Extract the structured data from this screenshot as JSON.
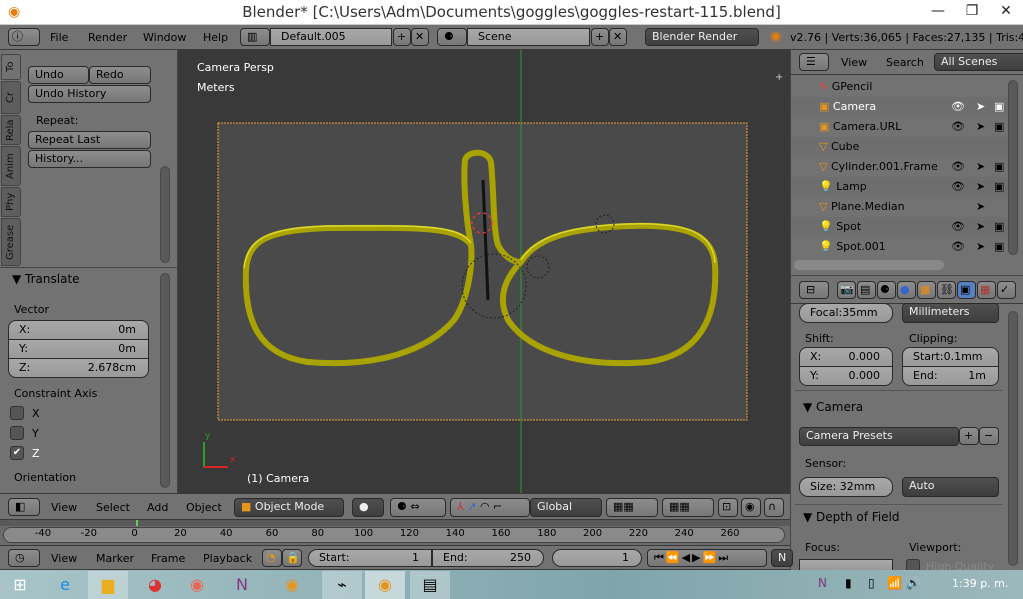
{
  "window": {
    "title": "Blender* [C:\\Users\\Adm\\Documents\\goggles\\goggles-restart-115.blend]",
    "minimize": "—",
    "maximize": "❐",
    "close": "✕"
  },
  "info_header": {
    "menus": [
      "File",
      "Render",
      "Window",
      "Help"
    ],
    "screen_layout": "Default.005",
    "scene": "Scene",
    "render_engine": "Blender Render",
    "stats": "v2.76 | Verts:36,065 | Faces:27,135 | Tris:4"
  },
  "tool_tabs": [
    "To",
    "Cr",
    "Rela",
    "Anim",
    "Phy",
    "Grease"
  ],
  "tools": {
    "undo": "Undo",
    "redo": "Redo",
    "undo_history": "Undo History",
    "repeat_label": "Repeat:",
    "repeat_last": "Repeat Last",
    "history": "History..."
  },
  "operator": {
    "title": "Translate",
    "vector_label": "Vector",
    "x_label": "X:",
    "x": "0m",
    "y_label": "Y:",
    "y": "0m",
    "z_label": "Z:",
    "z": "2.678cm",
    "constraint_label": "Constraint Axis",
    "axes": [
      {
        "label": "X",
        "checked": false
      },
      {
        "label": "Y",
        "checked": false
      },
      {
        "label": "Z",
        "checked": true
      }
    ],
    "orientation_label": "Orientation"
  },
  "viewport": {
    "view_name": "Camera Persp",
    "units": "Meters",
    "object_label": "(1) Camera",
    "axis_x": "x",
    "axis_y": "y",
    "frame_color": "#f0a030",
    "object_color": "#b8b400"
  },
  "view3d_header": {
    "menus": [
      "View",
      "Select",
      "Add",
      "Object"
    ],
    "mode": "Object Mode",
    "orientation": "Global"
  },
  "timeline": {
    "ticks": [
      "-40",
      "-20",
      "0",
      "20",
      "40",
      "60",
      "80",
      "100",
      "120",
      "140",
      "160",
      "180",
      "200",
      "220",
      "240",
      "260"
    ],
    "menus": [
      "View",
      "Marker",
      "Frame",
      "Playback"
    ],
    "start_label": "Start:",
    "start": "1",
    "end_label": "End:",
    "end": "250",
    "current": "1",
    "extra": "N"
  },
  "outliner": {
    "menus": [
      "View",
      "Search"
    ],
    "filter": "All Scenes",
    "items": [
      {
        "name": "GPencil",
        "icon": "pencil-icon",
        "visible": false
      },
      {
        "name": "Camera",
        "icon": "camera-icon",
        "visible": true,
        "active": true
      },
      {
        "name": "Camera.URL",
        "icon": "camera-icon",
        "visible": true
      },
      {
        "name": "Cube",
        "icon": "mesh-icon",
        "visible": false
      },
      {
        "name": "Cylinder.001.Frame",
        "icon": "mesh-icon",
        "visible": true
      },
      {
        "name": "Lamp",
        "icon": "lamp-icon",
        "visible": true
      },
      {
        "name": "Plane.Median",
        "icon": "mesh-icon",
        "visible": false
      },
      {
        "name": "Spot",
        "icon": "lamp-icon",
        "visible": true
      },
      {
        "name": "Spot.001",
        "icon": "lamp-icon",
        "visible": true
      }
    ]
  },
  "properties": {
    "focal": "Focal:35mm",
    "lens_unit": "Millimeters",
    "shift_label": "Shift:",
    "shift_x_label": "X:",
    "shift_x": "0.000",
    "shift_y_label": "Y:",
    "shift_y": "0.000",
    "clipping_label": "Clipping:",
    "clip_start": "Start:0.1mm",
    "clip_end_label": "End:",
    "clip_end": "1m",
    "camera_panel": "Camera",
    "camera_presets": "Camera Presets",
    "sensor_label": "Sensor:",
    "sensor_size": "Size:  32mm",
    "sensor_fit": "Auto",
    "dof_panel": "Depth of Field",
    "focus_label": "Focus:",
    "viewport_label": "Viewport:",
    "high_quality": "High Quality"
  },
  "taskbar": {
    "clock": "1:39 p. m."
  }
}
